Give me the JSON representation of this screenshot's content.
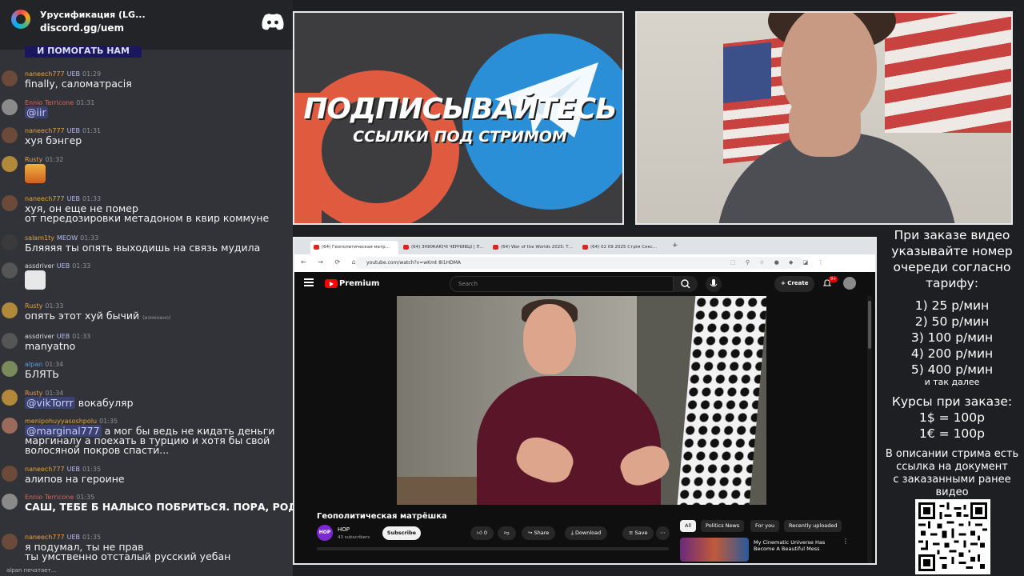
{
  "chat": {
    "server_name": "Урусификация (LG...",
    "invite": "discord.gg/uem",
    "banner": "И ПОМОГАТЬ НАМ",
    "typing": "alpan печатает...",
    "messages": [
      {
        "user": "naneech777",
        "user_color": "#e9a23b",
        "badge": "UEB",
        "time": "01:29",
        "text": "finally, саломатрасія"
      },
      {
        "user": "Ennio Terricone",
        "user_color": "#e0645a",
        "badge": "",
        "time": "01:31",
        "mention": "@iir",
        "text": ""
      },
      {
        "user": "naneech777",
        "user_color": "#e9a23b",
        "badge": "UEB",
        "time": "01:31",
        "text": "хуя бэнгер"
      },
      {
        "user": "Rusty",
        "user_color": "#e9a23b",
        "badge": "",
        "time": "01:32",
        "text": ""
      },
      {
        "user": "naneech777",
        "user_color": "#e9a23b",
        "badge": "UEB",
        "time": "01:33",
        "text": "хуя, он еще не помер",
        "text2": "от передозировки метадоном в квир коммуне"
      },
      {
        "user": "salam1ty",
        "user_color": "#e9a23b",
        "badge": "MEOW",
        "time": "01:33",
        "text": "Бляяяя ты опять выходишь на связь мудила"
      },
      {
        "user": "assdriver",
        "user_color": "#dbdee1",
        "badge": "UEB",
        "time": "01:33",
        "text": ""
      },
      {
        "user": "Rusty",
        "user_color": "#e9a23b",
        "badge": "",
        "time": "01:33",
        "text": "опять этот хуй бычий",
        "edited": "(изменено)"
      },
      {
        "user": "assdriver",
        "user_color": "#dbdee1",
        "badge": "UEB",
        "time": "01:33",
        "text": "manyatno"
      },
      {
        "user": "alpan",
        "user_color": "#5aa0e6",
        "badge": "",
        "time": "01:34",
        "text": "БЛЯТЬ"
      },
      {
        "user": "Rusty",
        "user_color": "#e9a23b",
        "badge": "",
        "time": "01:34",
        "mention": "@vikTorrr",
        "text": "вокабуляр"
      },
      {
        "user": "menipohuyyasoshpolu",
        "user_color": "#e9a23b",
        "badge": "",
        "time": "01:35",
        "mention": "@marginal777",
        "text": "а мог бы ведь не кидать деньги",
        "text2": "маргиналу а поехать в турцию и хотя бы свой",
        "text3": "волосяной покров спасти..."
      },
      {
        "user": "naneech777",
        "user_color": "#e9a23b",
        "badge": "UEB",
        "time": "01:35",
        "text": "алипов на героине"
      },
      {
        "user": "Ennio Terricone",
        "user_color": "#e0645a",
        "badge": "",
        "time": "01:35",
        "text": "САШ, ТЕБЕ Б НАЛЫСО ПОБРИТЬСЯ. ПОРА, РОДНОЙ!"
      },
      {
        "user": "naneech777",
        "user_color": "#e9a23b",
        "badge": "UEB",
        "time": "01:35",
        "text": "я подумал, ты не прав",
        "text2": "ты умственно отсталый русский уебан"
      }
    ]
  },
  "promo": {
    "title": "ПОДПИСЫВАЙТЕСЬ",
    "subtitle": "ССЫЛКИ ПОД СТРИМОМ"
  },
  "browser": {
    "tabs": [
      {
        "label": "(64) Геополитическая матр..."
      },
      {
        "label": "(64) ЗНИЖАЮЧІ ЧЕРНИВЦІ | П..."
      },
      {
        "label": "(64) War of the Worlds 2025: Т..."
      },
      {
        "label": "(64) 02 09 2025 Стрім Секс..."
      }
    ],
    "url": "youtube.com/watch?v=wKmt 8I1HDMA",
    "youtube": {
      "brand": "Premium",
      "search_placeholder": "Search",
      "create_label": "+ Create",
      "notif_count": "9+",
      "video_title": "Геополитическая матрёшка",
      "channel_initials": "HOP",
      "channel_name": "HOP",
      "subscribers": "43 subscribers",
      "subscribe": "Subscribe",
      "likes": "0",
      "share": "Share",
      "download": "Download",
      "save": "Save",
      "chips": [
        "All",
        "Politics News",
        "For you",
        "Recently uploaded"
      ],
      "rec_title": "My Cinematic Universe Has Become A Beautiful Mess"
    }
  },
  "info": {
    "order_lines": [
      "При заказе видео",
      "указывайте номер",
      "очереди согласно",
      "тарифу:"
    ],
    "tariffs": [
      "1) 25 р/мин",
      "2) 50 р/мин",
      "3) 100 р/мин",
      "4) 200 р/мин",
      "5) 400 р/мин"
    ],
    "and_more": "и так далее",
    "rates_title": [
      "Курсы при заказе:",
      "1$ = 100р",
      "1€ = 100р"
    ],
    "desc_lines": [
      "В описании стрима есть",
      "ссылка на документ",
      "с заказанными ранее",
      "видео"
    ]
  }
}
